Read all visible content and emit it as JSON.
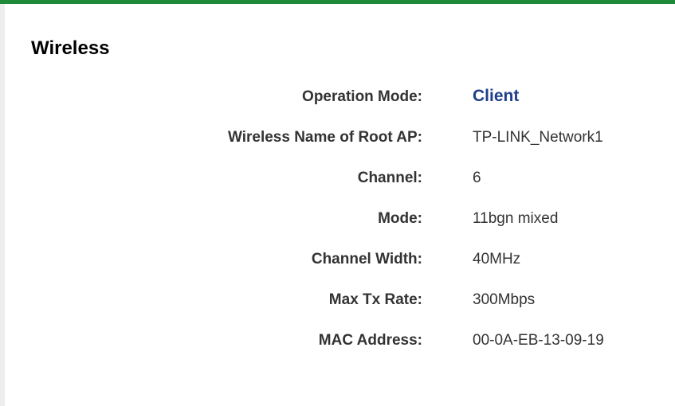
{
  "section": {
    "title": "Wireless"
  },
  "fields": [
    {
      "label": "Operation Mode:",
      "value": "Client"
    },
    {
      "label": "Wireless Name of Root AP:",
      "value": "TP-LINK_Network1"
    },
    {
      "label": "Channel:",
      "value": "6"
    },
    {
      "label": "Mode:",
      "value": "11bgn mixed"
    },
    {
      "label": "Channel Width:",
      "value": "40MHz"
    },
    {
      "label": "Max Tx Rate:",
      "value": "300Mbps"
    },
    {
      "label": "MAC Address:",
      "value": "00-0A-EB-13-09-19"
    }
  ],
  "colors": {
    "top_bar": "#1f8a3a",
    "highlight_value": "#1f3f8a",
    "text": "#333333"
  }
}
